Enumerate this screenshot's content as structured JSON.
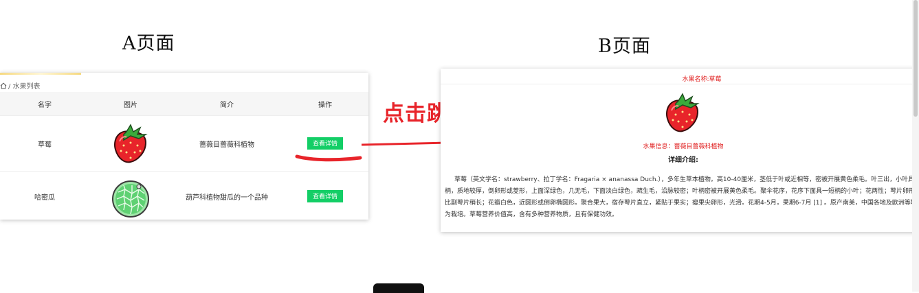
{
  "captions": {
    "a": "A页面",
    "b": "B页面"
  },
  "page_a": {
    "breadcrumb": "/ 水果列表",
    "table": {
      "headers": [
        "名字",
        "图片",
        "简介",
        "操作"
      ],
      "rows": [
        {
          "name": "草莓",
          "image": "strawberry-image",
          "intro": "蔷薇目蔷薇科植物",
          "action": "查看详情"
        },
        {
          "name": "哈密瓜",
          "image": "melon-image",
          "intro": "葫芦科植物甜瓜的一个品种",
          "action": "查看详情"
        }
      ]
    }
  },
  "annotation": {
    "label": "点击跳转",
    "color": "#e8242a"
  },
  "page_b": {
    "title": "水果名称:草莓",
    "info": "水果信息：蔷薇目蔷薇科植物",
    "subtitle": "详细介绍:",
    "description": "草莓（英文学名：strawberry、拉丁学名：Fragaria × ananassa Duch.），多年生草本植物。高10-40厘米，茎低于叶或近相等，密被开展黄色柔毛。叶三出，小叶具短柄，质地较厚，倒卵形或菱形，上面深绿色，几无毛，下面淡白绿色，疏生毛，沿脉较密；叶柄密被开展黄色柔毛。聚伞花序，花序下面具一短柄的小叶；花两性；萼片卵形，比副萼片稍长；花瓣白色，近圆形或倒卵椭圆形。聚合果大，宿存萼片直立，紧贴于果实；瘦果尖卵形，光滑。花期4-5月，果期6-7月 [1] 。原产南美，中国各地及欧洲等地广为栽培。草莓营养价值高，含有多种营养物质，且有保健功效。"
  },
  "colors": {
    "button": "#13ce66",
    "accent_red": "#e02020"
  }
}
